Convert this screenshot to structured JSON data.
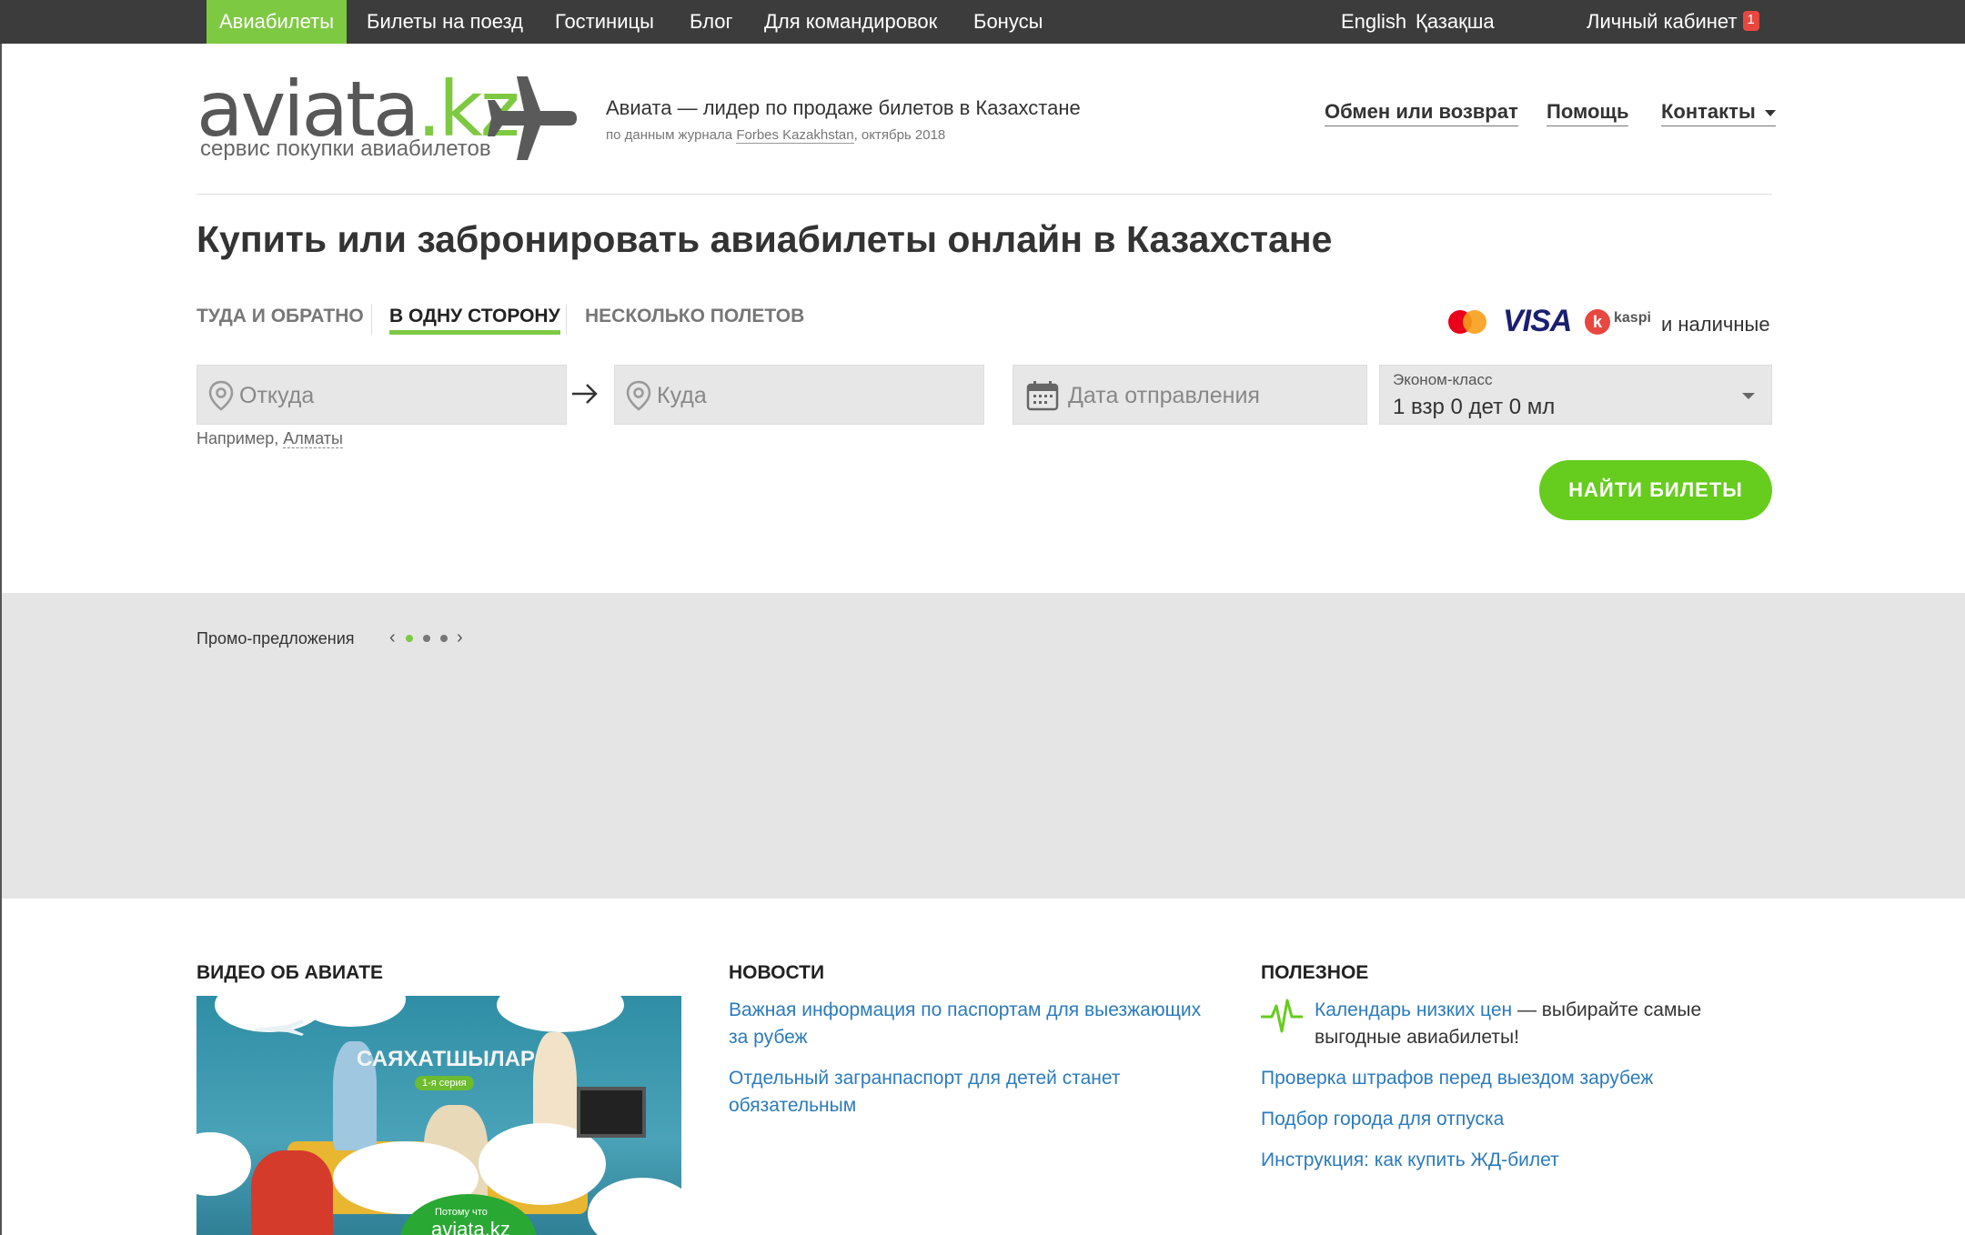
{
  "topnav": {
    "items": [
      {
        "label": "Авиабилеты",
        "active": true
      },
      {
        "label": "Билеты на поезд"
      },
      {
        "label": "Гостиницы"
      },
      {
        "label": "Блог"
      },
      {
        "label": "Для командировок"
      },
      {
        "label": "Бонусы"
      }
    ],
    "lang_en": "English",
    "lang_kz": "Қазақша",
    "account": "Личный кабинет",
    "account_badge": "1"
  },
  "header": {
    "logo_main": "aviata",
    "logo_tld": ".kz",
    "logo_sub": "сервис покупки авиабилетов",
    "tagline": "Авиата — лидер по продаже билетов в Казахстане",
    "tagline_sub_prefix": "по данным журнала",
    "tagline_sub_source": "Forbes Kazakhstan",
    "tagline_sub_suffix": ", октябрь 2018",
    "links": {
      "exchange": "Обмен или возврат",
      "help": "Помощь",
      "contacts": "Контакты"
    }
  },
  "page_title": "Купить или забронировать авиабилеты онлайн в Казахстане",
  "tabs": {
    "round_trip": "Туда и обратно",
    "one_way": "В одну сторону",
    "multi": "Несколько полетов"
  },
  "payments": {
    "visa": "VISA",
    "kaspi": "kaspi",
    "cash": "и наличные"
  },
  "form": {
    "from_placeholder": "Откуда",
    "to_placeholder": "Куда",
    "date_placeholder": "Дата отправления",
    "class": "Эконом-класс",
    "passengers": "1 взр 0 дет 0 мл",
    "example_prefix": "Например,",
    "example_city": "Алматы",
    "search_button": "Найти билеты"
  },
  "promo": {
    "label": "Промо-предложения"
  },
  "video": {
    "title": "Видео об Авиате",
    "thumb_title": "САЯХАТШЫЛАР",
    "thumb_pill": "1-я серия",
    "thumb_small": "Потому что",
    "thumb_logo": "aviata.kz"
  },
  "news": {
    "title": "Новости",
    "items": [
      {
        "line1": "Важная информация по паспортам для выезжающих",
        "line2": "за рубеж"
      },
      {
        "line1": "Отдельный загранпаспорт для детей станет",
        "line2": "обязательным"
      }
    ]
  },
  "useful": {
    "title": "Полезное",
    "calendar_link": "Календарь низких цен",
    "calendar_text": " — выбирайте самые",
    "calendar_text2": "выгодные авиабилеты!",
    "items": [
      "Проверка штрафов перед выездом зарубеж",
      "Подбор города для отпуска",
      "Инструкция: как купить ЖД-билет"
    ]
  },
  "colors": {
    "accent": "#7ec942",
    "button": "#66cc1e",
    "topbar": "#3c3c3c",
    "link": "#2b7bbd"
  }
}
